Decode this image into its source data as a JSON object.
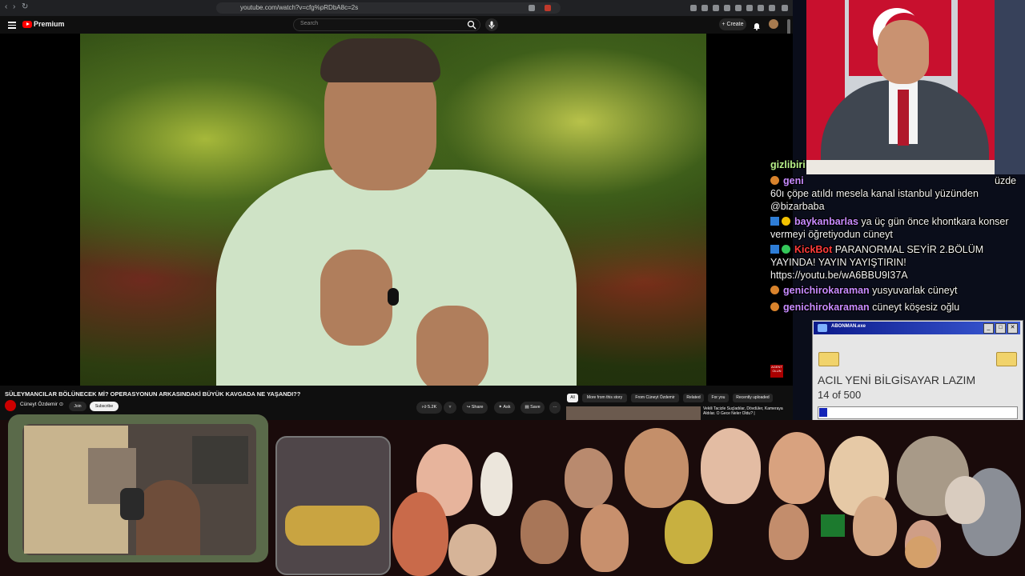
{
  "browser": {
    "url": "youtube.com/watch?v=cfg%pRDbA8c=2s"
  },
  "youtube": {
    "brand": "Premium",
    "search_placeholder": "Search",
    "create_label": "+ Create",
    "video_title": "SÜLEYMANCILAR BÖLÜNECEK Mİ? OPERASYONUN ARKASINDAKİ BÜYÜK KAVGADA NE YAŞANDI??",
    "channel_name": "Cüneyt Özdemir ⊙",
    "join_label": "Join",
    "subscribe_label": "Subscribe",
    "like_count": "5.2K",
    "share_label": "Share",
    "ask_label": "Ask",
    "save_label": "Save",
    "more_label": "···",
    "chips": [
      "All",
      "More from this story",
      "From Cüneyt Özdemir",
      "Related",
      "For you",
      "Recently uploaded"
    ],
    "rec_title": "Vekili Tacizle Suçladılar, Dövdüler, Kameraya Aldılar. O Gece Neler Oldu? |",
    "video_badge": "AGENT OLUN"
  },
  "chat": {
    "messages": [
      {
        "user": "gizlibiri",
        "text": "",
        "user_color": "#b9f28a"
      },
      {
        "user": "geni",
        "text": "",
        "user_color": "#c88bff",
        "suffix": "üzde"
      },
      {
        "user": "",
        "text": "60ı çöpe atıldı mesela kanal istanbul yüzünden @bizarbaba",
        "user_color": "#f2f2f2"
      },
      {
        "user": "baykanbarlas",
        "text": "ya üç gün önce khontkara konser vermeyi öğretiyodun cüneyt",
        "user_color": "#c88bff"
      },
      {
        "user": "KickBot",
        "text": "PARANORMAL SEYİR 2.BÖLÜM YAYINDA! YAYIN YAYIŞTIRIN! https://youtu.be/wA6BBU9I37A",
        "user_color": "#ff3b3b"
      },
      {
        "user": "genichirokaraman",
        "text": "yusyuvarlak cüneyt",
        "user_color": "#c88bff"
      },
      {
        "user": "genichirokaraman",
        "text": "cüneyt köşesiz oğlu",
        "user_color": "#c88bff"
      }
    ]
  },
  "popup": {
    "title": "ABONMAN.exe",
    "heading": "ACIL YENİ BİLGİSAYAR LAZIM",
    "count_text": "14 of 500",
    "progress_fraction": 0.028
  },
  "colors": {
    "accent_red": "#ff0000",
    "win_title": "#0c1a8a",
    "progress": "#1424b8"
  }
}
